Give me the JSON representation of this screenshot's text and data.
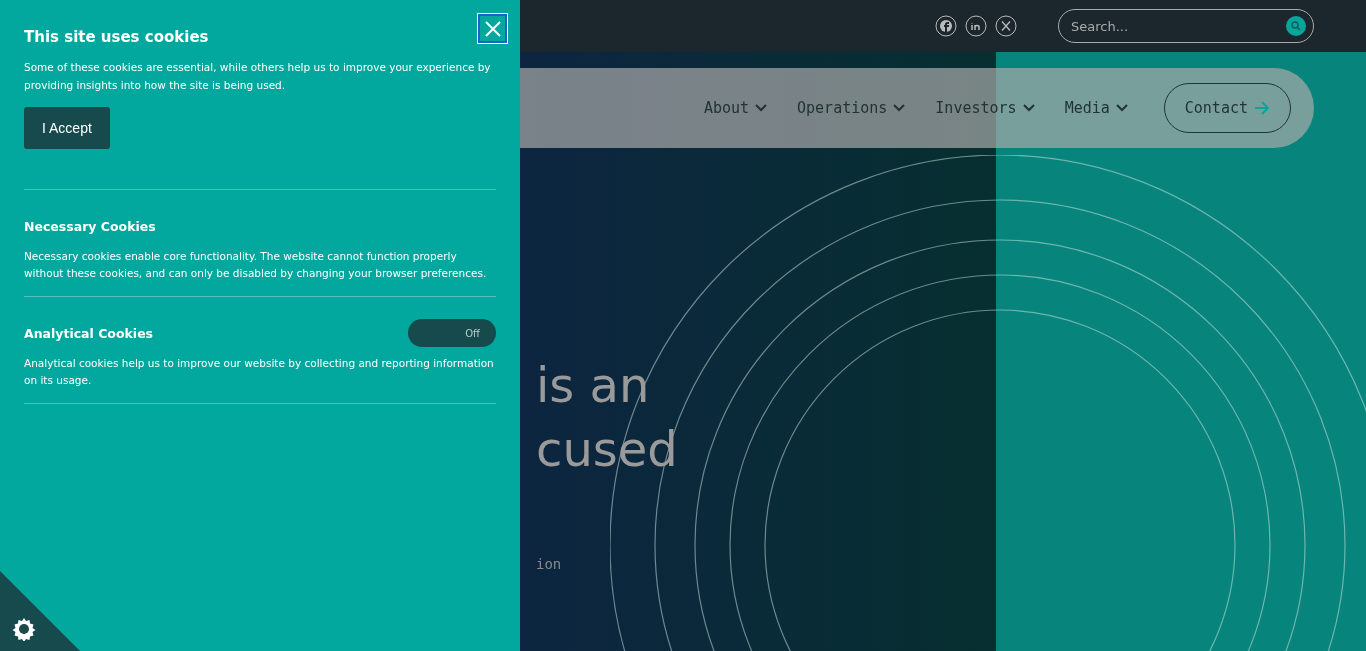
{
  "cookie_panel": {
    "title": "This site uses cookies",
    "intro": "Some of these cookies are essential, while others help us to improve your experience by providing insights into how the site is being used.",
    "accept_button": "I Accept",
    "sections": [
      {
        "kind": "text",
        "title": "Necessary Cookies",
        "description": "Necessary cookies enable core functionality. The website cannot function properly without these cookies, and can only be disabled by changing your browser preferences."
      },
      {
        "kind": "toggle",
        "title": "Analytical Cookies",
        "on": false,
        "toggle_label": "Off",
        "description": "Analytical cookies help us to improve our website by collecting and reporting information on its usage."
      }
    ]
  },
  "top_bar": {
    "search": {
      "placeholder": "Search..."
    }
  },
  "nav": {
    "items": [
      {
        "label": "About"
      },
      {
        "label": "Operations"
      },
      {
        "label": "Investors"
      },
      {
        "label": "Media"
      }
    ],
    "contact_button": "Contact"
  },
  "hero": {
    "heading_lines": [
      "is an",
      "cused"
    ],
    "subtext": "ion"
  }
}
